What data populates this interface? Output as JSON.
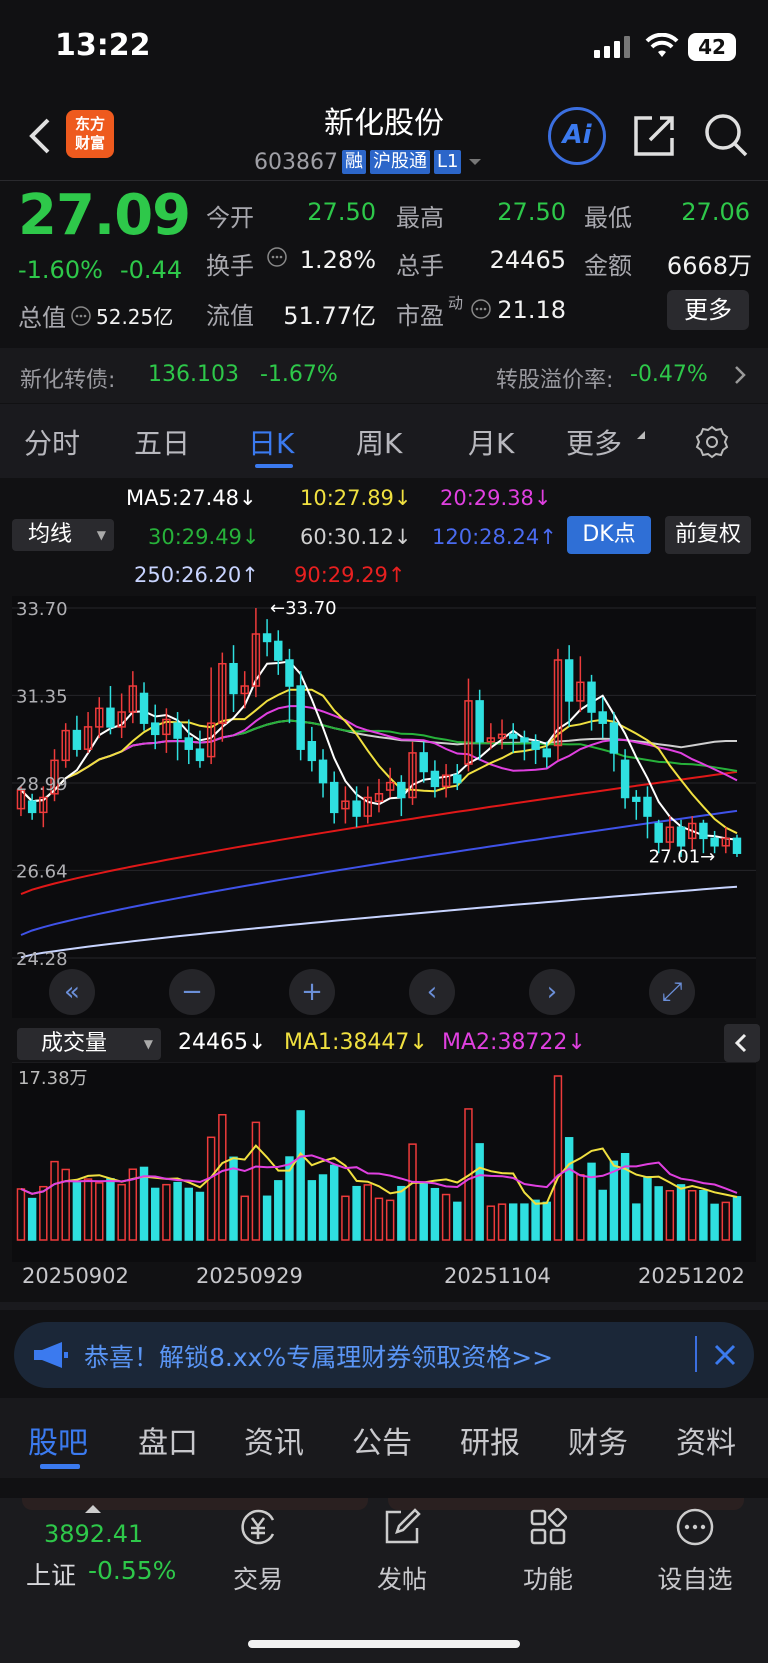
{
  "status_bar": {
    "time": "13:22",
    "battery": "42"
  },
  "header": {
    "stock_name": "新化股份",
    "stock_code": "603867",
    "tags": [
      "融",
      "沪股通",
      "L1"
    ],
    "logo_text": "东方\n财富",
    "ai_label": "Ai"
  },
  "quote": {
    "price": "27.09",
    "change_pct": "-1.60%",
    "change": "-0.44",
    "open_label": "今开",
    "open": "27.50",
    "high_label": "最高",
    "high": "27.50",
    "low_label": "最低",
    "low": "27.06",
    "turnover_label": "换手",
    "turnover": "1.28%",
    "volume_label": "总手",
    "volume": "24465",
    "amount_label": "金额",
    "amount": "6668万",
    "total_mv_label": "总值",
    "total_mv": "52.25亿",
    "float_mv_label": "流值",
    "float_mv": "51.77亿",
    "pe_label": "市盈",
    "pe_sup": "动",
    "pe": "21.18",
    "more_label": "更多"
  },
  "convertible": {
    "label": "新化转债:",
    "price": "136.103",
    "pct": "-1.67%",
    "premium_label": "转股溢价率:",
    "premium": "-0.47%"
  },
  "tabs": [
    "分时",
    "五日",
    "日K",
    "周K",
    "月K",
    "更多"
  ],
  "active_tab": "日K",
  "ma": {
    "selector": "均线",
    "ma5": "MA5:27.48",
    "ma10": "10:27.89",
    "ma20": "20:29.38",
    "ma30": "30:29.49",
    "ma60": "60:30.12",
    "ma120": "120:28.24",
    "ma250": "250:26.20",
    "ma90": "90:29.29",
    "dk_label": "DK点",
    "fq_label": "前复权"
  },
  "colors": {
    "up": "#ee3b3b",
    "down": "#2fe0e0",
    "ma5": "#ffffff",
    "ma10": "#f0e040",
    "ma20": "#e040e0",
    "ma30": "#27b13a",
    "ma60": "#cfcfcf",
    "ma120": "#3f52e8",
    "ma250": "#c8d4ff",
    "ma90": "#e01818",
    "accent": "#3b7aef"
  },
  "chart_data": {
    "type": "candlestick",
    "y_ticks": [
      "33.70",
      "31.35",
      "28.99",
      "26.64",
      "24.28"
    ],
    "ylim": [
      24.28,
      33.7
    ],
    "high_marker": "33.70",
    "low_marker": "27.01",
    "x_labels": [
      "20250902",
      "20250929",
      "20251104",
      "20251202"
    ],
    "candles": [
      [
        28.3,
        28.8,
        28.1,
        28.9
      ],
      [
        28.5,
        28.2,
        28.0,
        28.7
      ],
      [
        28.2,
        28.6,
        27.8,
        28.9
      ],
      [
        28.7,
        29.6,
        28.5,
        29.9
      ],
      [
        29.6,
        30.4,
        29.4,
        30.6
      ],
      [
        30.4,
        29.9,
        29.7,
        30.8
      ],
      [
        29.9,
        30.5,
        29.8,
        30.9
      ],
      [
        30.5,
        31.0,
        30.2,
        31.3
      ],
      [
        31.0,
        30.5,
        30.3,
        31.6
      ],
      [
        30.5,
        30.9,
        30.2,
        31.4
      ],
      [
        30.9,
        31.6,
        30.6,
        32.0
      ],
      [
        31.4,
        30.6,
        30.4,
        31.7
      ],
      [
        30.6,
        30.3,
        29.9,
        31.1
      ],
      [
        30.3,
        30.7,
        29.8,
        31.0
      ],
      [
        30.6,
        30.2,
        29.6,
        30.9
      ],
      [
        30.2,
        29.9,
        29.5,
        30.7
      ],
      [
        29.9,
        29.6,
        29.4,
        30.4
      ],
      [
        29.7,
        30.6,
        29.5,
        32.1
      ],
      [
        30.6,
        32.2,
        30.1,
        32.5
      ],
      [
        32.2,
        31.4,
        30.9,
        32.7
      ],
      [
        31.4,
        31.6,
        31.0,
        32.0
      ],
      [
        31.6,
        33.0,
        31.3,
        33.7
      ],
      [
        33.0,
        32.8,
        32.4,
        33.4
      ],
      [
        32.8,
        32.3,
        31.9,
        33.1
      ],
      [
        32.3,
        31.6,
        30.6,
        32.6
      ],
      [
        31.6,
        29.9,
        29.6,
        32.0
      ],
      [
        30.1,
        29.6,
        29.3,
        30.5
      ],
      [
        29.6,
        29.0,
        28.6,
        29.9
      ],
      [
        29.0,
        28.2,
        27.9,
        29.3
      ],
      [
        28.3,
        28.5,
        27.9,
        28.9
      ],
      [
        28.5,
        28.1,
        27.8,
        28.9
      ],
      [
        28.1,
        28.6,
        27.9,
        28.9
      ],
      [
        28.5,
        28.7,
        28.2,
        29.1
      ],
      [
        28.8,
        29.0,
        28.6,
        29.4
      ],
      [
        29.0,
        28.6,
        28.1,
        29.2
      ],
      [
        28.6,
        29.8,
        28.4,
        30.1
      ],
      [
        29.8,
        29.3,
        29.0,
        30.1
      ],
      [
        29.3,
        28.9,
        28.6,
        29.6
      ],
      [
        28.9,
        29.2,
        28.6,
        29.5
      ],
      [
        29.2,
        29.0,
        28.8,
        29.5
      ],
      [
        29.5,
        31.2,
        29.3,
        31.8
      ],
      [
        31.2,
        30.1,
        29.6,
        31.5
      ],
      [
        30.1,
        30.2,
        29.9,
        30.6
      ],
      [
        30.2,
        30.3,
        29.9,
        30.7
      ],
      [
        30.3,
        30.2,
        29.8,
        30.6
      ],
      [
        30.2,
        30.1,
        29.6,
        30.4
      ],
      [
        30.1,
        29.9,
        29.5,
        30.3
      ],
      [
        29.9,
        29.7,
        29.4,
        30.1
      ],
      [
        30.0,
        32.3,
        29.6,
        32.6
      ],
      [
        32.3,
        31.2,
        30.5,
        32.7
      ],
      [
        31.2,
        31.7,
        30.9,
        32.4
      ],
      [
        31.7,
        30.9,
        30.4,
        31.9
      ],
      [
        30.9,
        30.6,
        30.2,
        31.3
      ],
      [
        30.6,
        29.8,
        29.3,
        30.9
      ],
      [
        29.6,
        28.6,
        28.3,
        29.9
      ],
      [
        28.6,
        28.5,
        28.0,
        28.8
      ],
      [
        28.6,
        28.1,
        27.5,
        28.9
      ],
      [
        27.9,
        27.4,
        27.1,
        28.0
      ],
      [
        27.4,
        27.8,
        27.2,
        28.1
      ],
      [
        27.8,
        27.3,
        27.0,
        28.0
      ],
      [
        27.5,
        27.9,
        27.2,
        28.1
      ],
      [
        27.9,
        27.5,
        27.1,
        28.0
      ],
      [
        27.5,
        27.3,
        27.1,
        27.7
      ],
      [
        27.3,
        27.5,
        27.1,
        27.8
      ],
      [
        27.5,
        27.1,
        27.0,
        27.6
      ]
    ],
    "volume_label": "成交量",
    "volume_today": "24465",
    "vol_ma1": "MA1:38447",
    "vol_ma2": "MA2:38722",
    "vol_top_label": "17.38万"
  },
  "nav_buttons": [
    "first",
    "zoom-out",
    "zoom-in",
    "prev",
    "next",
    "fullscreen"
  ],
  "banner": {
    "text": "恭喜！解锁8.xx%专属理财券领取资格>>"
  },
  "bottom_tabs": [
    "股吧",
    "盘口",
    "资讯",
    "公告",
    "研报",
    "财务",
    "资料"
  ],
  "footer": {
    "index_value": "3892.41",
    "index_name": "上证",
    "index_pct": "-0.55%",
    "items": [
      "交易",
      "发帖",
      "功能",
      "设自选"
    ]
  }
}
